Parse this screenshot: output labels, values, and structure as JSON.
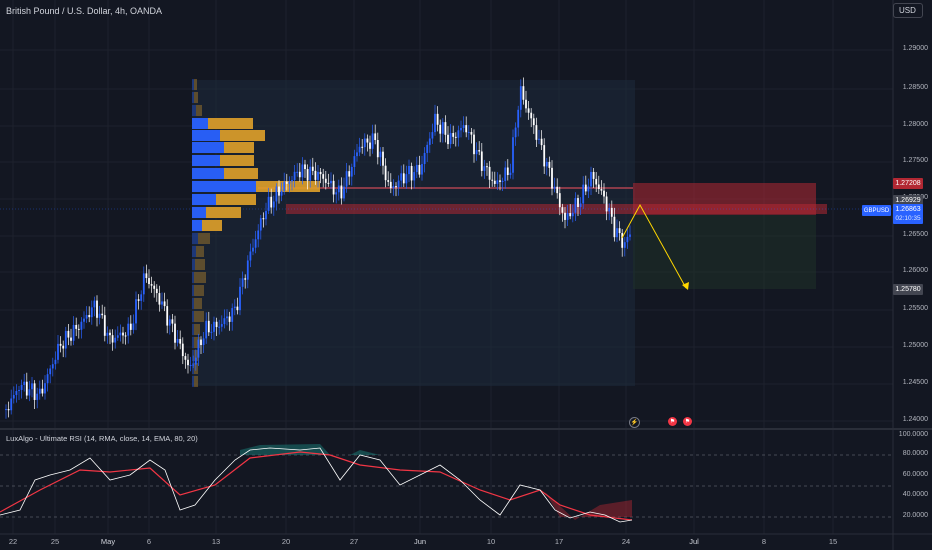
{
  "header": {
    "title": "British Pound / U.S. Dollar, 4h, OANDA",
    "currency": "USD"
  },
  "price_axis": {
    "labels": [
      "1.29000",
      "1.28500",
      "1.28000",
      "1.27500",
      "1.27000",
      "1.26500",
      "1.26000",
      "1.25500",
      "1.25000",
      "1.24500",
      "1.24000"
    ],
    "tags": {
      "level_a": "1.27208",
      "level_b": "1.26929",
      "symbol": "GBPUSD",
      "last_price": "1.26863",
      "countdown": "02:10:35",
      "target": "1.25780"
    }
  },
  "indicator": {
    "title": "LuxAlgo - Ultimate RSI (14, RMA, close, 14, EMA, 80, 20)",
    "labels": [
      "100.0000",
      "80.0000",
      "60.0000",
      "40.0000",
      "20.0000"
    ]
  },
  "time_axis": {
    "labels": [
      "22",
      "25",
      "May",
      "6",
      "13",
      "20",
      "27",
      "Jun",
      "10",
      "17",
      "24",
      "Jul",
      "8",
      "15"
    ]
  },
  "colors": {
    "background": "#131722",
    "bull_candle": "#2962ff",
    "bear_candle": "#ffffff",
    "resistance_line": "#f7525f",
    "zone_red": "#b22833",
    "volume_profile_blue": "#2962ff",
    "volume_profile_yellow": "#e0a12a",
    "rsi_line": "#ffffff",
    "signal_line": "#f23645",
    "projection": "#ffd700"
  },
  "icons": {
    "event_1": "lightning-icon",
    "event_2": "flag-icon",
    "event_3": "flag-icon"
  }
}
